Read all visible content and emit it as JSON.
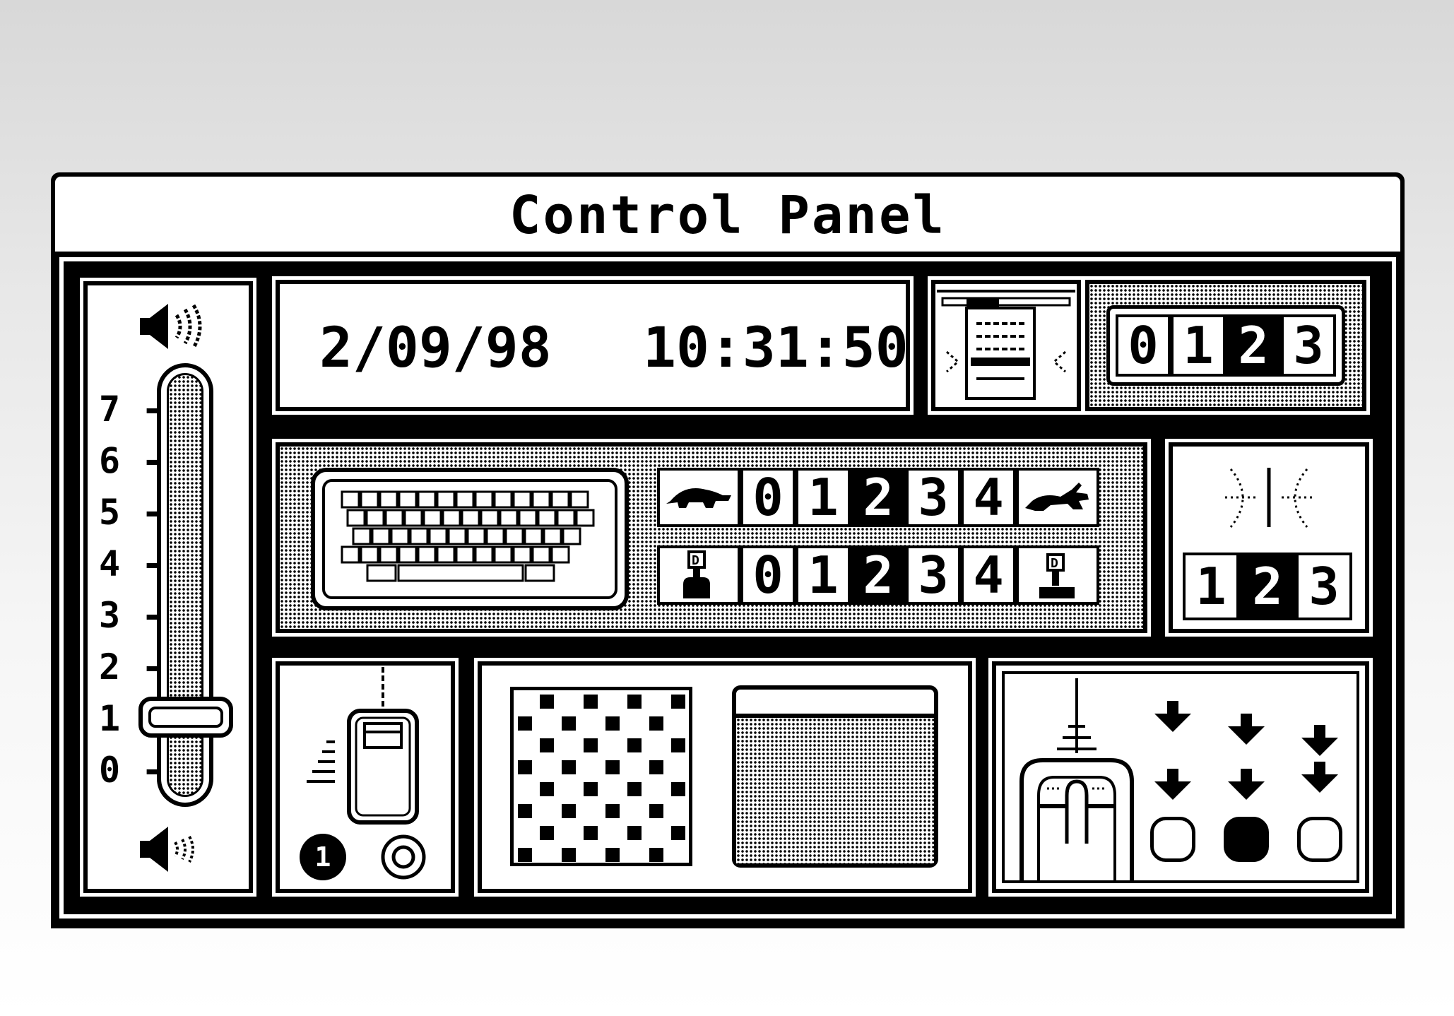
{
  "window": {
    "title": "Control Panel"
  },
  "datetime": {
    "date": "2/09/98",
    "time": "10:31:50"
  },
  "volume": {
    "scale": [
      "7",
      "6",
      "5",
      "4",
      "3",
      "2",
      "1",
      "0"
    ],
    "level": 1
  },
  "menu_blink": {
    "options": [
      "0",
      "1",
      "2",
      "3"
    ],
    "selected": 2
  },
  "key_repeat_rate": {
    "options": [
      "0",
      "1",
      "2",
      "3",
      "4"
    ],
    "selected": 2
  },
  "key_repeat_delay": {
    "options": [
      "0",
      "1",
      "2",
      "3",
      "4"
    ],
    "selected": 2
  },
  "caret_blink": {
    "options": [
      "1",
      "2",
      "3"
    ],
    "selected": 1
  },
  "disk_cache": {
    "label": "1"
  },
  "mouse_double_click": {
    "selected": 1
  },
  "icons": {
    "volume_high": "speaker-loud-icon",
    "volume_low": "speaker-soft-icon",
    "menu_blink": "menu-blink-icon",
    "keyboard": "keyboard-icon",
    "slow_rate": "tortoise-icon",
    "fast_rate": "hare-icon",
    "long_delay": "key-press-long-icon",
    "short_delay": "key-press-short-icon",
    "caret": "insertion-point-icon",
    "mouse_tracking": "mouse-icon",
    "mouse_tracking_option": "radio-icon",
    "desktop_pattern": "pattern-icon",
    "desktop_preview": "desktop-preview-icon",
    "double_click_mouse": "mouse-button-icon",
    "arrow": "down-arrow-icon"
  },
  "colors": {
    "foreground": "#000000",
    "background": "#ffffff"
  }
}
